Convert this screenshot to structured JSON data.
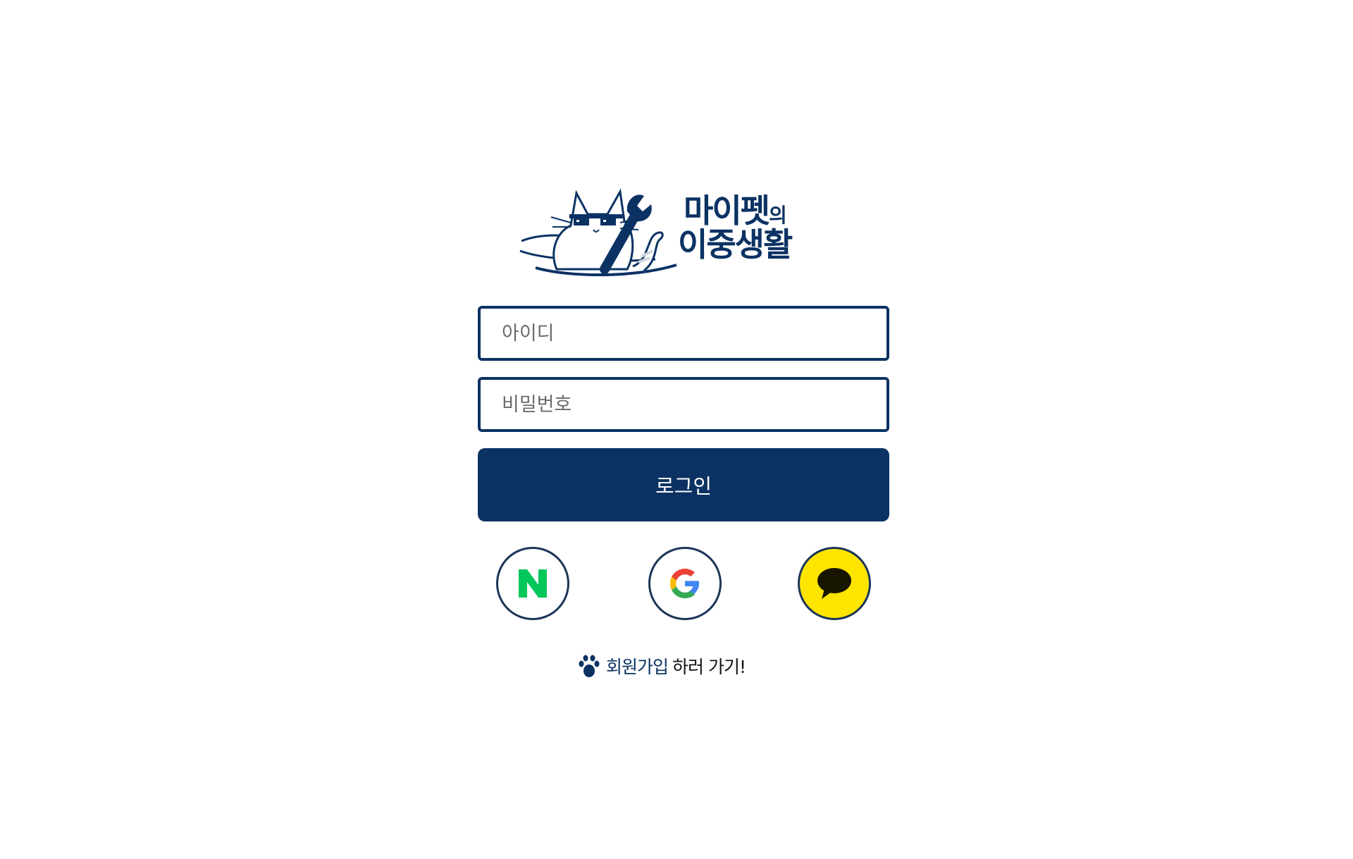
{
  "brand": {
    "logo_line1_main": "마이펫",
    "logo_line1_small": "의",
    "logo_line2": "이중생활",
    "color_primary": "#0b3263"
  },
  "login_form": {
    "id_placeholder": "아이디",
    "password_placeholder": "비밀번호",
    "login_button_label": "로그인"
  },
  "social_login": [
    {
      "name": "naver",
      "icon": "naver-n-icon",
      "color": "#03c75a"
    },
    {
      "name": "google",
      "icon": "google-g-icon",
      "color": "#ffffff"
    },
    {
      "name": "kakao",
      "icon": "kakao-speech-bubble-icon",
      "color": "#fee500"
    }
  ],
  "signup": {
    "icon": "paw-icon",
    "link_text": "회원가입",
    "suffix_text": "하러 가기!"
  }
}
